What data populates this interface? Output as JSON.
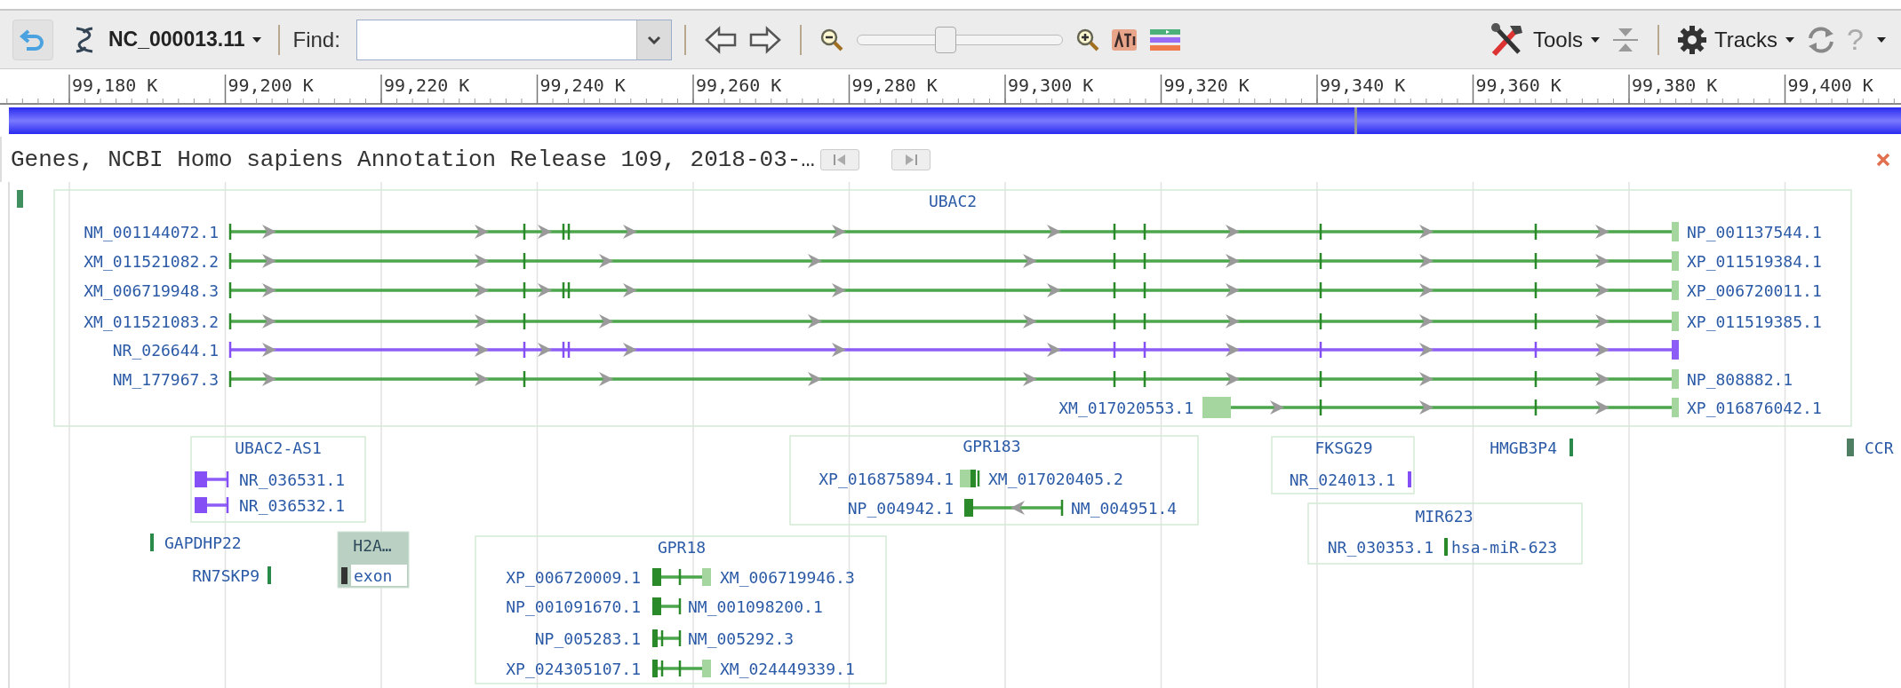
{
  "toolbar": {
    "sequence": "NC_000013.11",
    "find_label": "Find:",
    "zoom_slider": {
      "level": 0.43
    },
    "tools": "Tools",
    "tracks": "Tracks",
    "help": "?"
  },
  "ruler": {
    "ticks": [
      "99,180 K",
      "99,200 K",
      "99,220 K",
      "99,240 K",
      "99,260 K",
      "99,280 K",
      "99,300 K",
      "99,320 K",
      "99,340 K",
      "99,360 K",
      "99,380 K",
      "99,400 K"
    ]
  },
  "track": {
    "title": "Genes, NCBI Homo sapiens Annotation Release 109, 2018-03-…",
    "groups": [
      {
        "name": "UBAC2",
        "transcripts": [
          {
            "left_label": "NM_001144072.1",
            "right_label": "NP_001137544.1",
            "kind": "coding"
          },
          {
            "left_label": "XM_011521082.2",
            "right_label": "XP_011519384.1",
            "kind": "coding"
          },
          {
            "left_label": "XM_006719948.3",
            "right_label": "XP_006720011.1",
            "kind": "coding"
          },
          {
            "left_label": "XM_011521083.2",
            "right_label": "XP_011519385.1",
            "kind": "coding"
          },
          {
            "left_label": "NR_026644.1",
            "kind": "noncoding"
          },
          {
            "left_label": "NM_177967.3",
            "right_label": "NP_808882.1",
            "kind": "coding"
          },
          {
            "left_label": "XM_017020553.1",
            "right_label": "XP_016876042.1",
            "kind": "coding"
          }
        ]
      },
      {
        "name": "UBAC2-AS1",
        "transcripts": [
          {
            "right_label": "NR_036531.1",
            "kind": "noncoding"
          },
          {
            "right_label": "NR_036532.1",
            "kind": "noncoding"
          }
        ]
      },
      {
        "name": "GPR183",
        "transcripts": [
          {
            "left_label": "XP_016875894.1",
            "right_label": "XM_017020405.2",
            "kind": "coding"
          },
          {
            "left_label": "NP_004942.1",
            "right_label": "NM_004951.4",
            "kind": "coding"
          }
        ]
      },
      {
        "name": "FKSG29",
        "transcripts": [
          {
            "left_label": "NR_024013.1",
            "kind": "noncoding"
          }
        ]
      },
      {
        "name": "MIR623",
        "transcripts": [
          {
            "left_label": "NR_030353.1",
            "right_label": "hsa-miR-623",
            "kind": "mirna"
          }
        ]
      },
      {
        "name": "GPR18",
        "transcripts": [
          {
            "left_label": "XP_006720009.1",
            "right_label": "XM_006719946.3",
            "kind": "coding"
          },
          {
            "left_label": "NP_001091670.1",
            "right_label": "NM_001098200.1",
            "kind": "coding"
          },
          {
            "left_label": "NP_005283.1",
            "right_label": "NM_005292.3",
            "kind": "coding"
          },
          {
            "left_label": "XP_024305107.1",
            "right_label": "XM_024449339.1",
            "kind": "coding"
          }
        ]
      }
    ],
    "features": [
      {
        "label": "GAPDHP22"
      },
      {
        "label": "RN7SKP9"
      },
      {
        "label": "HMGB3P4"
      },
      {
        "label": "CCR"
      }
    ],
    "selected_feature": {
      "title": "H2A…",
      "label": "exon"
    }
  }
}
